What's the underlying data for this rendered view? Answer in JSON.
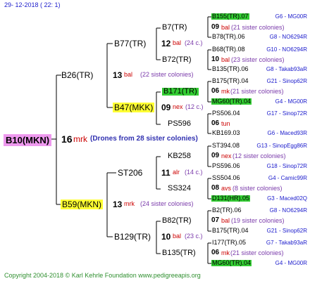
{
  "header": {
    "date": "29- 12-2018 ( 22: 1)"
  },
  "footer": {
    "copyright": "Copyright 2004-2018 © Karl Kehrle Foundation www.pedigreeapis.org"
  },
  "root": {
    "name": "B10(MKN)",
    "gen": "16",
    "place": "mrk",
    "note": "(Drones from 28 sister colonies)"
  },
  "gen2": [
    {
      "name": "B26(TR)",
      "gen": "13",
      "place": "bal",
      "note": "(22 sister colonies)"
    },
    {
      "name": "B59(MKN)",
      "gen": "13",
      "place": "mrk",
      "note": "(24 sister colonies)"
    }
  ],
  "gen3": [
    {
      "name": "B77(TR)",
      "gen": "12",
      "place": "bal",
      "note": "(24 c.)"
    },
    {
      "name": "B47(MKK)",
      "gen": "09",
      "place": "nex",
      "note": "(12 c.)"
    },
    {
      "name": "ST206",
      "gen": "11",
      "place": "alr",
      "note": "(14 c.)"
    },
    {
      "name": "B129(TR)",
      "gen": "10",
      "place": "bal",
      "note": "(23 c.)"
    }
  ],
  "gen4": [
    {
      "name": "B7(TR)",
      "gen": "09",
      "place": "bal",
      "note": "(21 sister colonies)"
    },
    {
      "name": "B72(TR)",
      "gen": "10",
      "place": "bal",
      "note": "(23 sister colonies)"
    },
    {
      "name": "B171(TR)",
      "gen": "06",
      "place": "mk",
      "note": "(21 sister colonies)"
    },
    {
      "name": "PS596",
      "gen": "06",
      "place": "tun",
      "note": ""
    },
    {
      "name": "KB258",
      "gen": "09",
      "place": "nex",
      "note": "(12 sister colonies)"
    },
    {
      "name": "SS324",
      "gen": "08",
      "place": "avs",
      "note": "(8 sister colonies)"
    },
    {
      "name": "B82(TR)",
      "gen": "07",
      "place": "bal",
      "note": "(19 sister colonies)"
    },
    {
      "name": "B135(TR)",
      "gen": "06",
      "place": "mk",
      "note": "(21 sister colonies)"
    }
  ],
  "gen5": [
    {
      "name": "B155(TR).07",
      "code": "G6 - MG00R"
    },
    {
      "name": "B78(TR).06",
      "code": "G8 - NO6294R"
    },
    {
      "name": "B68(TR).08",
      "code": "G10 - NO6294R"
    },
    {
      "name": "B135(TR).06",
      "code": "G8 - Takab93aR"
    },
    {
      "name": "B175(TR).04",
      "code": "G21 - Sinop62R"
    },
    {
      "name": "MG60(TR).04",
      "code": "G4 - MG00R"
    },
    {
      "name": "PS506.04",
      "code": "G17 - Sinop72R"
    },
    {
      "name": "KB169.03",
      "code": "G6 - Maced93R"
    },
    {
      "name": "ST394.08",
      "code": "G13 - SinopEgg86R"
    },
    {
      "name": "PS596.06",
      "code": "G18 - Sinop72R"
    },
    {
      "name": "SS504.06",
      "code": "G4 - Camic99R"
    },
    {
      "name": "D131(HR).05",
      "code": "G3 - Maced02Q"
    },
    {
      "name": "B2(TR).06",
      "code": "G8 - NO6294R"
    },
    {
      "name": "B175(TR).04",
      "code": "G21 - Sinop62R"
    },
    {
      "name": "I177(TR).05",
      "code": "G7 - Takab93aR"
    },
    {
      "name": "MG60(TR).04",
      "code": "G4 - MG00R"
    }
  ],
  "colors": {
    "lines": "#000000",
    "root_highlight": "#ee99ee",
    "name_highlight": "#ffff33",
    "leaf_highlight": "#33cc33",
    "place": "#cc0000",
    "code": "#1a1acc",
    "footer": "#2f8f2f"
  }
}
